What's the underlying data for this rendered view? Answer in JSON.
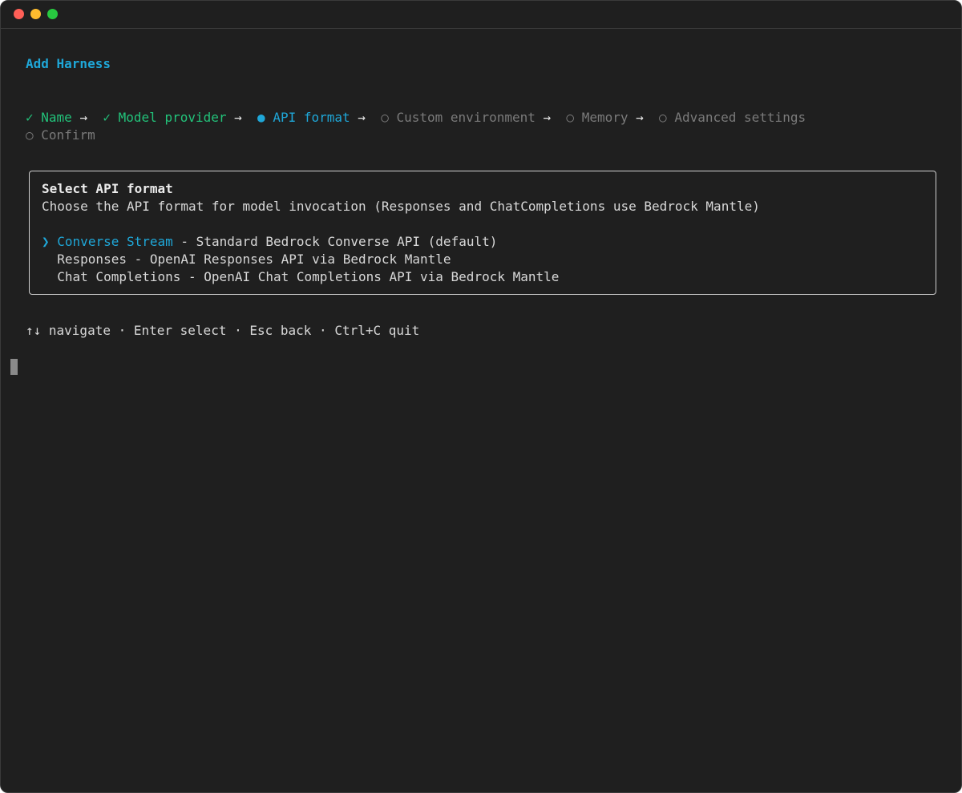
{
  "window": {
    "controls": [
      "close",
      "minimize",
      "zoom"
    ]
  },
  "header": {
    "title": "Add Harness"
  },
  "steps": [
    {
      "marker": "✓",
      "label": "Name",
      "state": "done"
    },
    {
      "marker": "✓",
      "label": "Model provider",
      "state": "done"
    },
    {
      "marker": "●",
      "label": "API format",
      "state": "current"
    },
    {
      "marker": "○",
      "label": "Custom environment",
      "state": "pending"
    },
    {
      "marker": "○",
      "label": "Memory",
      "state": "pending"
    },
    {
      "marker": "○",
      "label": "Advanced settings",
      "state": "pending"
    },
    {
      "marker": "○",
      "label": "Confirm",
      "state": "pending"
    }
  ],
  "step_separator": "→",
  "panel": {
    "heading": "Select API format",
    "description": "Choose the API format for model invocation (Responses and ChatCompletions use Bedrock Mantle)",
    "pointer": "❯",
    "options": [
      {
        "name": "Converse Stream",
        "description": " - Standard Bedrock Converse API (default)",
        "selected": true
      },
      {
        "name": "Responses",
        "description": " - OpenAI Responses API via Bedrock Mantle",
        "selected": false
      },
      {
        "name": "Chat Completions",
        "description": " - OpenAI Chat Completions API via Bedrock Mantle",
        "selected": false
      }
    ]
  },
  "help": "↑↓ navigate · Enter select · Esc back · Ctrl+C quit",
  "colors": {
    "background": "#1f1f1f",
    "accent": "#1fa7d8",
    "done": "#22c27a",
    "pending": "#7a7a7a",
    "text": "#d8d8d8"
  }
}
